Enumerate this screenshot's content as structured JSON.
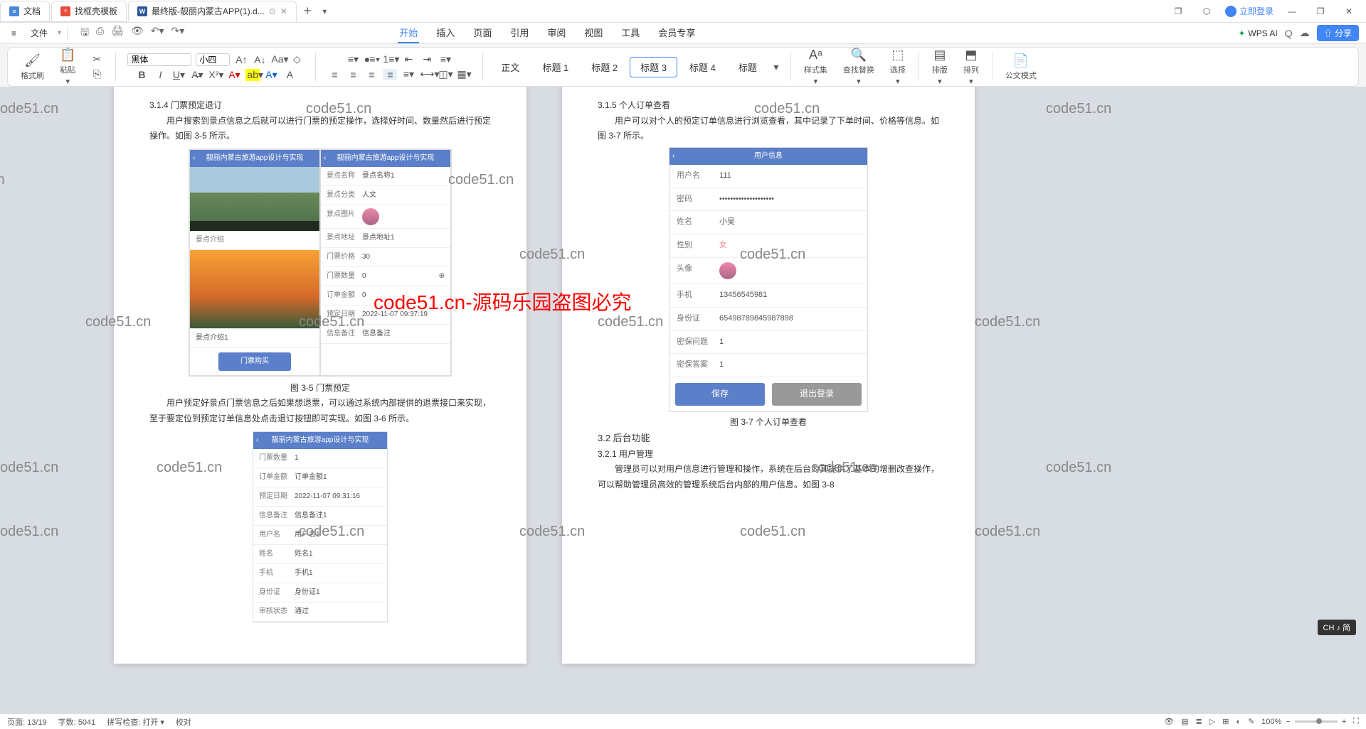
{
  "tabs": [
    {
      "icon": "doc-blue",
      "label": "文档"
    },
    {
      "icon": "doc-red",
      "label": "找框壳模板"
    },
    {
      "icon": "word",
      "label": "最终版-靓丽内蒙古APP(1).d..."
    }
  ],
  "login": "立即登录",
  "fileMenu": "文件",
  "menus": [
    "开始",
    "插入",
    "页面",
    "引用",
    "审阅",
    "视图",
    "工具",
    "会员专享"
  ],
  "wpsAi": "WPS AI",
  "shareBtn": "分享",
  "font": {
    "name": "黑体",
    "size": "小四"
  },
  "ribbonLabels": {
    "formatBrush": "格式刷",
    "paste": "粘贴"
  },
  "styles": [
    "正文",
    "标题 1",
    "标题 2",
    "标题 3",
    "标题 4",
    "标题"
  ],
  "ribbonRight": {
    "styleSet": "样式集",
    "findReplace": "查找替换",
    "select": "选择",
    "layout": "排版",
    "arrange": "排列",
    "officialDoc": "公文模式"
  },
  "leftPage": {
    "sec314": "3.1.4  门票预定退订",
    "p1": "用户搜索到景点信息之后就可以进行门票的预定操作，选择好时间、数量然后进行预定操作。如图 3-5 所示。",
    "cap35": "图 3-5  门票预定",
    "p2": "用户预定好景点门票信息之后如果想退票，可以通过系统内部提供的退票接口来实现，至于要定位到预定订单信息处点击退订按钮即可实现。如图 3-6 所示。",
    "appTitle": "靓丽内蒙古旅游app设计与实现",
    "scenic": {
      "name_k": "景点名称",
      "name_v": "景点名称1",
      "cat_k": "景点分类",
      "cat_v": "人文",
      "img_k": "景点图片",
      "addr_k": "景点地址",
      "addr_v": "景点地址1",
      "price_k": "门票价格",
      "price_v": "30",
      "qty_k": "门票数量",
      "qty_v": "0",
      "amt_k": "订单金额",
      "amt_v": "0",
      "date_k": "预定日期",
      "date_v": "2022-11-07 09:37:19",
      "remark_k": "信息备注",
      "remark_v": "信息备注",
      "intro_k": "景点介绍",
      "intro_v": "景点介绍1",
      "buyBtn": "门票购买"
    },
    "refund": {
      "qty_k": "门票数量",
      "qty_v": "1",
      "amt_k": "订单金额",
      "amt_v": "订单金额1",
      "date_k": "预定日期",
      "date_v": "2022-11-07 09:31:16",
      "remark_k": "信息备注",
      "remark_v": "信息备注1",
      "uname_k": "用户名",
      "uname_v": "用户名1",
      "name_k": "姓名",
      "name_v": "姓名1",
      "phone_k": "手机",
      "phone_v": "手机1",
      "idcard_k": "身份证",
      "idcard_v": "身份证1",
      "status_k": "审核状态",
      "status_v": "通过"
    }
  },
  "rightPage": {
    "sec315": "3.1.5  个人订单查看",
    "p1": "用户可以对个人的预定订单信息进行浏览查看，其中记录了下单时间、价格等信息。如图 3-7 所示。",
    "cap37": "图 3-7 个人订单查看",
    "sec32": "3.2  后台功能",
    "sec321": "3.2.1  用户管理",
    "p2": "管理员可以对用户信息进行管理和操作，系统在后台为其提供了基本的增删改查操作，可以帮助管理员高效的管理系统后台内部的用户信息。如图 3-8",
    "userHeader": "用户信息",
    "user": {
      "uname_k": "用户名",
      "uname_v": "111",
      "pwd_k": "密码",
      "pwd_v": "••••••••••••••••••••",
      "name_k": "姓名",
      "name_v": "小吴",
      "gender_k": "性别",
      "gender_v": "女",
      "avatar_k": "头像",
      "phone_k": "手机",
      "phone_v": "13456545981",
      "idcard_k": "身份证",
      "idcard_v": "65498789845987898",
      "q_k": "密保问题",
      "q_v": "1",
      "a_k": "密保答案",
      "a_v": "1",
      "saveBtn": "保存",
      "logoutBtn": "退出登录"
    }
  },
  "status": {
    "page": "页面: 13/19",
    "words": "字数: 5041",
    "spell": "拼写检查: 打开",
    "proof": "校对",
    "zoom": "100%"
  },
  "ime": "CH ♪ 简",
  "redMark": "code51.cn-源码乐园盗图必究",
  "wm": "code51.cn"
}
